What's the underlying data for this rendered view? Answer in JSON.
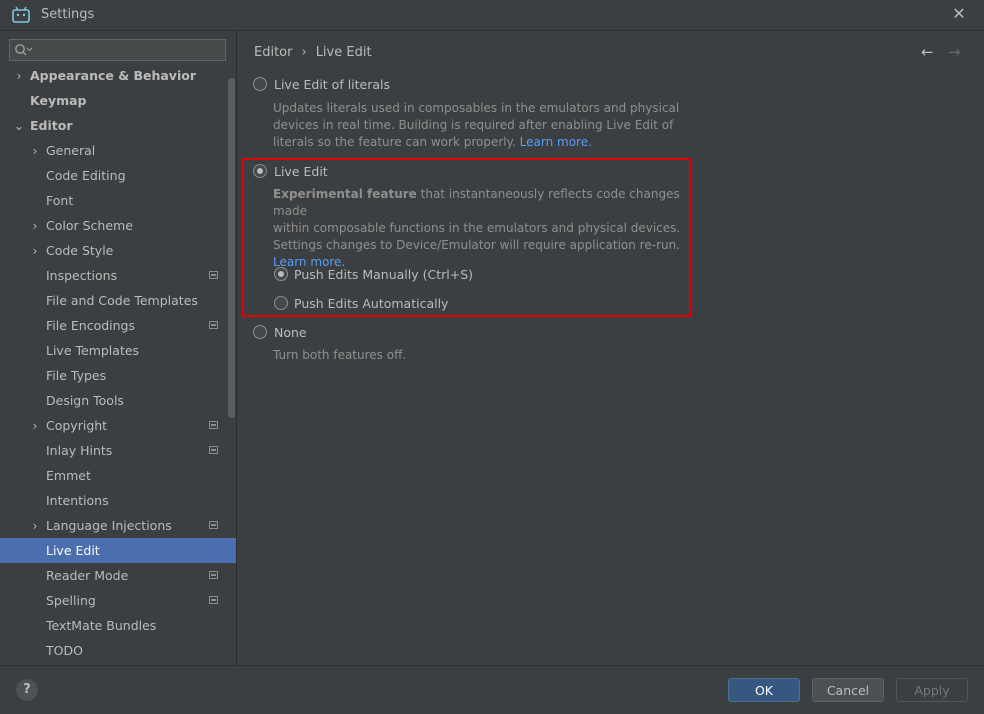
{
  "window": {
    "title": "Settings",
    "close_glyph": "✕"
  },
  "search": {
    "placeholder": ""
  },
  "sidebar": {
    "items": [
      {
        "label": "Appearance & Behavior",
        "chevron": "›",
        "badge": false
      },
      {
        "label": "Keymap",
        "chevron": "",
        "badge": false
      },
      {
        "label": "Editor",
        "chevron": "⌄",
        "badge": false
      },
      {
        "label": "General",
        "chevron": "›",
        "badge": false
      },
      {
        "label": "Code Editing",
        "chevron": "",
        "badge": false
      },
      {
        "label": "Font",
        "chevron": "",
        "badge": false
      },
      {
        "label": "Color Scheme",
        "chevron": "›",
        "badge": false
      },
      {
        "label": "Code Style",
        "chevron": "›",
        "badge": false
      },
      {
        "label": "Inspections",
        "chevron": "",
        "badge": true
      },
      {
        "label": "File and Code Templates",
        "chevron": "",
        "badge": false
      },
      {
        "label": "File Encodings",
        "chevron": "",
        "badge": true
      },
      {
        "label": "Live Templates",
        "chevron": "",
        "badge": false
      },
      {
        "label": "File Types",
        "chevron": "",
        "badge": false
      },
      {
        "label": "Design Tools",
        "chevron": "",
        "badge": false
      },
      {
        "label": "Copyright",
        "chevron": "›",
        "badge": true
      },
      {
        "label": "Inlay Hints",
        "chevron": "",
        "badge": true
      },
      {
        "label": "Emmet",
        "chevron": "",
        "badge": false
      },
      {
        "label": "Intentions",
        "chevron": "",
        "badge": false
      },
      {
        "label": "Language Injections",
        "chevron": "›",
        "badge": true
      },
      {
        "label": "Live Edit",
        "chevron": "",
        "badge": false,
        "selected": true
      },
      {
        "label": "Reader Mode",
        "chevron": "",
        "badge": true
      },
      {
        "label": "Spelling",
        "chevron": "",
        "badge": true
      },
      {
        "label": "TextMate Bundles",
        "chevron": "",
        "badge": false
      },
      {
        "label": "TODO",
        "chevron": "",
        "badge": false
      }
    ]
  },
  "breadcrumb": {
    "parent": "Editor",
    "separator": "›",
    "current": "Live Edit",
    "back_glyph": "←",
    "forward_glyph": "→"
  },
  "options": {
    "literals": {
      "label": "Live Edit of literals",
      "desc_line1": "Updates literals used in composables in the emulators and physical",
      "desc_line2": "devices in real time. Building is required after enabling Live Edit of",
      "desc_line3": "literals so the feature can work properly.",
      "learn_more": "Learn more.",
      "checked": false
    },
    "live_edit": {
      "label": "Live Edit",
      "desc_bold": "Experimental feature",
      "desc_line1_rest": " that instantaneously reflects code changes made",
      "desc_line2": "within composable functions in the emulators and physical devices.",
      "desc_line3": "Settings changes to Device/Emulator will require application re-run.",
      "learn_more": "Learn more.",
      "checked": true,
      "sub_manual": {
        "label": "Push Edits Manually (Ctrl+S)",
        "checked": true
      },
      "sub_auto": {
        "label": "Push Edits Automatically",
        "checked": false
      }
    },
    "none": {
      "label": "None",
      "desc": "Turn both features off.",
      "checked": false
    }
  },
  "footer": {
    "help": "?",
    "ok": "OK",
    "cancel": "Cancel",
    "apply": "Apply"
  },
  "colors": {
    "accent": "#4b6eaf",
    "highlight_box": "#e00000",
    "link": "#589df6"
  }
}
